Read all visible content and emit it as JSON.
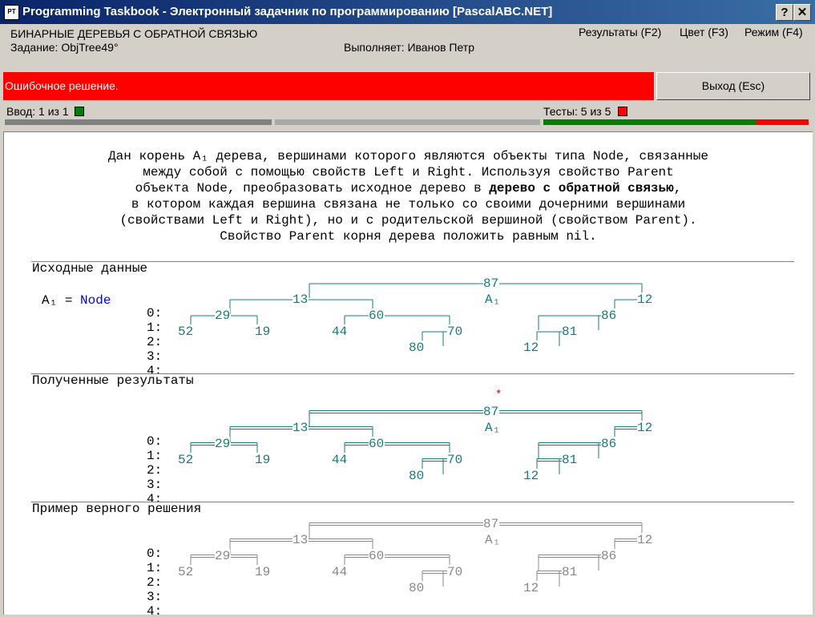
{
  "window": {
    "title": "Programming Taskbook - Электронный задачник по программированию [PascalABC.NET]",
    "icon_text": "PT",
    "help_btn": "?",
    "close_btn": "✕"
  },
  "header": {
    "topic": "БИНАРНЫЕ ДЕРЕВЬЯ С ОБРАТНОЙ СВЯЗЬЮ",
    "task": "Задание: ObjTree49°",
    "student": "Выполняет: Иванов Петр",
    "menu_results": "Результаты (F2)",
    "menu_color": "Цвет (F3)",
    "menu_mode": "Режим (F4)"
  },
  "status": {
    "message": "Ошибочное решение.",
    "exit_label": "Выход (Esc)",
    "input_label": "Ввод:  1 из 1",
    "tests_label": "Тесты:  5 из 5",
    "input_color": "#008000",
    "tests_color": "#ff0000",
    "tests_progress": {
      "passed_fraction": 0.8,
      "passed_color": "#008000",
      "failed_color": "#ff0000"
    }
  },
  "problem": {
    "line1": "Дан корень A₁ дерева, вершинами которого являются объекты типа Node, связанные",
    "line2": "между собой с помощью свойств Left и Right. Используя свойство Parent",
    "line3_a": "объекта Node, преобразовать исходное дерево в ",
    "line3_bold": "дерево с обратной связью",
    "line3_b": ",",
    "line4": "в котором каждая вершина связана не только со своими дочерними вершинами",
    "line5": "(свойствами Left и Right), но и с родительской вершиной (свойством Parent).",
    "line6": "Свойство Parent корня дерева положить равным nil."
  },
  "sections": {
    "input_title": "Исходные данные",
    "output_title": "Полученные результаты",
    "example_title": "Пример верного решения",
    "var_name": "A₁",
    "var_eq": "=",
    "var_type": "Node",
    "error_mark": "*"
  },
  "levels": [
    "0:",
    "1:",
    "2:",
    "3:",
    "4:"
  ],
  "tree": {
    "root_marker": "A₁",
    "nodes": [
      {
        "label": "87"
      },
      {
        "label": "13"
      },
      {
        "label": "12"
      },
      {
        "label": "29"
      },
      {
        "label": "60"
      },
      {
        "label": "86"
      },
      {
        "label": "52"
      },
      {
        "label": "19"
      },
      {
        "label": "44"
      },
      {
        "label": "70"
      },
      {
        "label": "81"
      },
      {
        "label": "80"
      },
      {
        "label": "12"
      }
    ]
  },
  "colors": {
    "tree_primary": "#1a7a7a",
    "tree_example": "#888888",
    "node_type": "#0000ff",
    "error_mark": "#cc0000"
  }
}
